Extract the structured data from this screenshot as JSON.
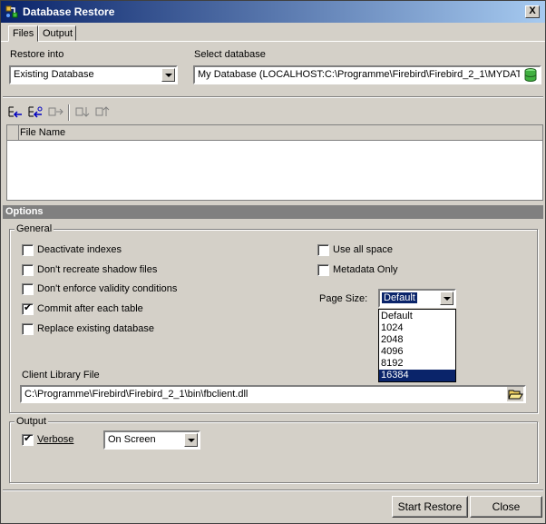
{
  "window": {
    "title": "Database Restore",
    "close_glyph": "X"
  },
  "tabs": [
    {
      "label": "Files"
    },
    {
      "label": "Output"
    }
  ],
  "files": {
    "restore_into_label": "Restore into",
    "restore_into_value": "Existing Database",
    "select_database_label": "Select database",
    "select_database_value": "My Database (LOCALHOST:C:\\Programme\\Firebird\\Firebird_2_1\\MYDAT."
  },
  "toolbar": {
    "buttons": [
      {
        "icon": "add-file-icon"
      },
      {
        "icon": "add-file-alt-icon"
      },
      {
        "icon": "remove-file-icon"
      },
      {
        "icon": "move-down-icon"
      },
      {
        "icon": "move-up-icon"
      }
    ]
  },
  "file_list": {
    "column_header": "File Name"
  },
  "options": {
    "header": "Options",
    "general": {
      "title": "General",
      "checkboxes": [
        {
          "label": "Deactivate indexes",
          "checked": false
        },
        {
          "label": "Don't recreate shadow files",
          "checked": false
        },
        {
          "label": "Don't enforce validity conditions",
          "checked": false
        },
        {
          "label": "Commit after each table",
          "checked": true
        },
        {
          "label": "Replace existing database",
          "checked": false
        }
      ],
      "right_checkboxes": [
        {
          "label": "Use all space",
          "checked": false
        },
        {
          "label": "Metadata Only",
          "checked": false
        }
      ],
      "page_size_label": "Page Size:",
      "page_size_value": "Default",
      "page_size_options": [
        "Default",
        "1024",
        "2048",
        "4096",
        "8192",
        "16384"
      ],
      "page_size_highlighted": "16384",
      "client_library_label": "Client Library File",
      "client_library_value": "C:\\Programme\\Firebird\\Firebird_2_1\\bin\\fbclient.dll"
    },
    "output": {
      "title": "Output",
      "verbose_label": "Verbose",
      "verbose_checked": true,
      "target_value": "On Screen"
    }
  },
  "buttons": {
    "start_restore": "Start Restore",
    "close": "Close"
  },
  "colors": {
    "title_start": "#0a246a",
    "title_end": "#a6caf0",
    "face": "#d4d0c8",
    "selection": "#0a246a",
    "options_bar": "#808080"
  }
}
